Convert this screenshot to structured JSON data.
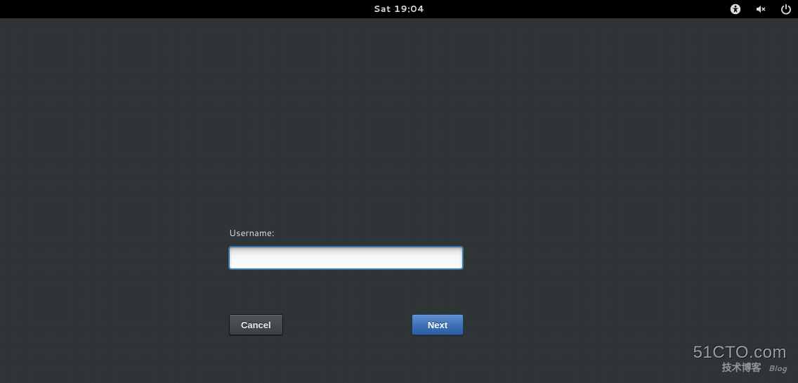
{
  "topbar": {
    "clock": "Sat 19:04",
    "icons": {
      "accessibility": "accessibility-icon",
      "volume": "volume-muted-icon",
      "power": "power-icon"
    }
  },
  "login": {
    "username_label": "Username:",
    "username_value": "",
    "username_placeholder": ""
  },
  "buttons": {
    "cancel_label": "Cancel",
    "next_label": "Next"
  },
  "watermark": {
    "line1": "51CTO.com",
    "line2": "技术博客",
    "tag": "Blog"
  },
  "colors": {
    "background": "#2e3436",
    "topbar": "#000000",
    "primary": "#3a6db3",
    "input_outline": "#3a74a8"
  }
}
